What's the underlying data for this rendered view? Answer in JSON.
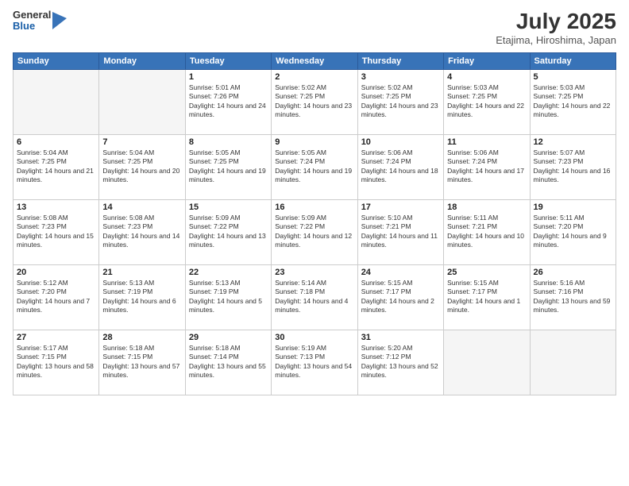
{
  "logo": {
    "general": "General",
    "blue": "Blue"
  },
  "header": {
    "month": "July 2025",
    "location": "Etajima, Hiroshima, Japan"
  },
  "weekdays": [
    "Sunday",
    "Monday",
    "Tuesday",
    "Wednesday",
    "Thursday",
    "Friday",
    "Saturday"
  ],
  "weeks": [
    [
      {
        "day": "",
        "text": ""
      },
      {
        "day": "",
        "text": ""
      },
      {
        "day": "1",
        "text": "Sunrise: 5:01 AM\nSunset: 7:26 PM\nDaylight: 14 hours and 24 minutes."
      },
      {
        "day": "2",
        "text": "Sunrise: 5:02 AM\nSunset: 7:25 PM\nDaylight: 14 hours and 23 minutes."
      },
      {
        "day": "3",
        "text": "Sunrise: 5:02 AM\nSunset: 7:25 PM\nDaylight: 14 hours and 23 minutes."
      },
      {
        "day": "4",
        "text": "Sunrise: 5:03 AM\nSunset: 7:25 PM\nDaylight: 14 hours and 22 minutes."
      },
      {
        "day": "5",
        "text": "Sunrise: 5:03 AM\nSunset: 7:25 PM\nDaylight: 14 hours and 22 minutes."
      }
    ],
    [
      {
        "day": "6",
        "text": "Sunrise: 5:04 AM\nSunset: 7:25 PM\nDaylight: 14 hours and 21 minutes."
      },
      {
        "day": "7",
        "text": "Sunrise: 5:04 AM\nSunset: 7:25 PM\nDaylight: 14 hours and 20 minutes."
      },
      {
        "day": "8",
        "text": "Sunrise: 5:05 AM\nSunset: 7:25 PM\nDaylight: 14 hours and 19 minutes."
      },
      {
        "day": "9",
        "text": "Sunrise: 5:05 AM\nSunset: 7:24 PM\nDaylight: 14 hours and 19 minutes."
      },
      {
        "day": "10",
        "text": "Sunrise: 5:06 AM\nSunset: 7:24 PM\nDaylight: 14 hours and 18 minutes."
      },
      {
        "day": "11",
        "text": "Sunrise: 5:06 AM\nSunset: 7:24 PM\nDaylight: 14 hours and 17 minutes."
      },
      {
        "day": "12",
        "text": "Sunrise: 5:07 AM\nSunset: 7:23 PM\nDaylight: 14 hours and 16 minutes."
      }
    ],
    [
      {
        "day": "13",
        "text": "Sunrise: 5:08 AM\nSunset: 7:23 PM\nDaylight: 14 hours and 15 minutes."
      },
      {
        "day": "14",
        "text": "Sunrise: 5:08 AM\nSunset: 7:23 PM\nDaylight: 14 hours and 14 minutes."
      },
      {
        "day": "15",
        "text": "Sunrise: 5:09 AM\nSunset: 7:22 PM\nDaylight: 14 hours and 13 minutes."
      },
      {
        "day": "16",
        "text": "Sunrise: 5:09 AM\nSunset: 7:22 PM\nDaylight: 14 hours and 12 minutes."
      },
      {
        "day": "17",
        "text": "Sunrise: 5:10 AM\nSunset: 7:21 PM\nDaylight: 14 hours and 11 minutes."
      },
      {
        "day": "18",
        "text": "Sunrise: 5:11 AM\nSunset: 7:21 PM\nDaylight: 14 hours and 10 minutes."
      },
      {
        "day": "19",
        "text": "Sunrise: 5:11 AM\nSunset: 7:20 PM\nDaylight: 14 hours and 9 minutes."
      }
    ],
    [
      {
        "day": "20",
        "text": "Sunrise: 5:12 AM\nSunset: 7:20 PM\nDaylight: 14 hours and 7 minutes."
      },
      {
        "day": "21",
        "text": "Sunrise: 5:13 AM\nSunset: 7:19 PM\nDaylight: 14 hours and 6 minutes."
      },
      {
        "day": "22",
        "text": "Sunrise: 5:13 AM\nSunset: 7:19 PM\nDaylight: 14 hours and 5 minutes."
      },
      {
        "day": "23",
        "text": "Sunrise: 5:14 AM\nSunset: 7:18 PM\nDaylight: 14 hours and 4 minutes."
      },
      {
        "day": "24",
        "text": "Sunrise: 5:15 AM\nSunset: 7:17 PM\nDaylight: 14 hours and 2 minutes."
      },
      {
        "day": "25",
        "text": "Sunrise: 5:15 AM\nSunset: 7:17 PM\nDaylight: 14 hours and 1 minute."
      },
      {
        "day": "26",
        "text": "Sunrise: 5:16 AM\nSunset: 7:16 PM\nDaylight: 13 hours and 59 minutes."
      }
    ],
    [
      {
        "day": "27",
        "text": "Sunrise: 5:17 AM\nSunset: 7:15 PM\nDaylight: 13 hours and 58 minutes."
      },
      {
        "day": "28",
        "text": "Sunrise: 5:18 AM\nSunset: 7:15 PM\nDaylight: 13 hours and 57 minutes."
      },
      {
        "day": "29",
        "text": "Sunrise: 5:18 AM\nSunset: 7:14 PM\nDaylight: 13 hours and 55 minutes."
      },
      {
        "day": "30",
        "text": "Sunrise: 5:19 AM\nSunset: 7:13 PM\nDaylight: 13 hours and 54 minutes."
      },
      {
        "day": "31",
        "text": "Sunrise: 5:20 AM\nSunset: 7:12 PM\nDaylight: 13 hours and 52 minutes."
      },
      {
        "day": "",
        "text": ""
      },
      {
        "day": "",
        "text": ""
      }
    ]
  ]
}
